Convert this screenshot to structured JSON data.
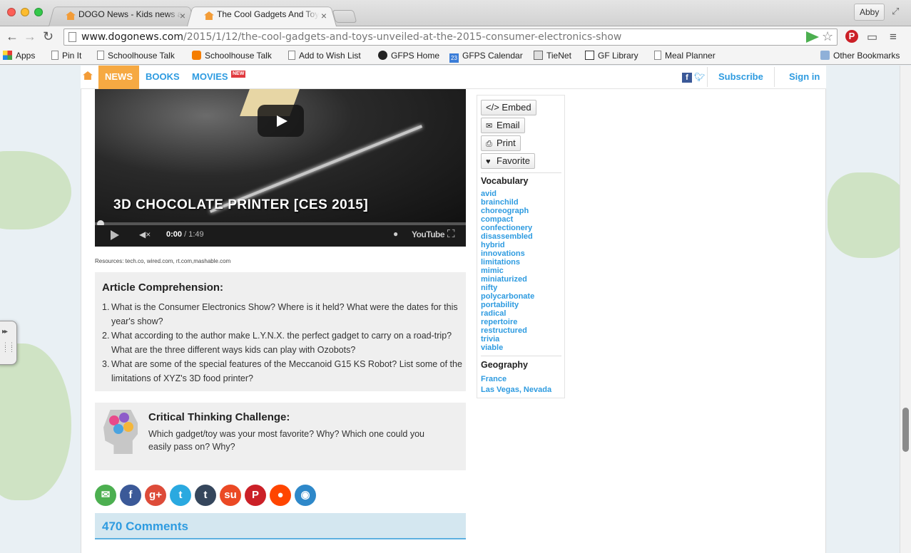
{
  "browser": {
    "tabs": [
      {
        "title": "DOGO News - Kids news a",
        "active": false
      },
      {
        "title": "The Cool Gadgets And Toy",
        "active": true
      }
    ],
    "profile_name": "Abby",
    "url_host": "www.dogonews.com",
    "url_path": "/2015/1/12/the-cool-gadgets-and-toys-unveiled-at-the-2015-consumer-electronics-show",
    "bookmarks": [
      "Apps",
      "Pin It",
      "Schoolhouse Talk",
      "Schoolhouse Talk",
      "Add to Wish List",
      "GFPS Home",
      "GFPS Calendar",
      "TieNet",
      "GF Library",
      "Meal Planner"
    ],
    "other_bookmarks": "Other Bookmarks",
    "calendar_day": "23"
  },
  "site_nav": {
    "news": "NEWS",
    "books": "BOOKS",
    "movies": "MOVIES",
    "movies_badge": "NEW",
    "subscribe": "Subscribe",
    "sign_in": "Sign in"
  },
  "video": {
    "title": "3D CHOCOLATE PRINTER [CES 2015]",
    "current_time": "0:00",
    "total_time": "/ 1:49",
    "youtube_label": "YouTube"
  },
  "resources": "Resources: tech.co, wired.com, rt.com,mashable.com",
  "comprehension": {
    "title": "Article Comprehension:",
    "questions": [
      {
        "num": "1.",
        "line1": "What is the Consumer Electronics Show? Where is it held? What were the dates for this",
        "line2": "year's show?"
      },
      {
        "num": "2.",
        "line1": "What according to the author make L.Y.N.X. the perfect gadget to carry on a road-trip?",
        "line2": "What are the three different ways kids can play with Ozobots?"
      },
      {
        "num": "3.",
        "line1": "What are some of the special features of the Meccanoid G15 KS Robot? List some of the",
        "line2": "limitations of XYZ's 3D food printer?"
      }
    ]
  },
  "critical_thinking": {
    "title": "Critical Thinking Challenge:",
    "line1": "Which gadget/toy was your most favorite? Why? Which one could you",
    "line2": "easily pass on? Why?"
  },
  "share_icons": [
    {
      "name": "email",
      "color": "#4caf50",
      "glyph": "✉"
    },
    {
      "name": "facebook",
      "color": "#3b5998",
      "glyph": "f"
    },
    {
      "name": "google-plus",
      "color": "#dd4b39",
      "glyph": "g+"
    },
    {
      "name": "twitter",
      "color": "#2aa9e0",
      "glyph": "t"
    },
    {
      "name": "tumblr",
      "color": "#35465c",
      "glyph": "t"
    },
    {
      "name": "stumbleupon",
      "color": "#eb4924",
      "glyph": "su"
    },
    {
      "name": "pinterest",
      "color": "#cb2027",
      "glyph": "P"
    },
    {
      "name": "reddit",
      "color": "#ff4500",
      "glyph": "●"
    },
    {
      "name": "other",
      "color": "#2e88c9",
      "glyph": "◉"
    }
  ],
  "comments": "470 Comments",
  "sidebar": {
    "embed": "</> Embed",
    "email": "Email",
    "print": "Print",
    "favorite": "Favorite",
    "vocab_title": "Vocabulary",
    "vocab": [
      "avid",
      "brainchild",
      "choreograph",
      "compact",
      "confectionery",
      "disassembled",
      "hybrid",
      "innovations",
      "limitations",
      "mimic",
      "miniaturized",
      "nifty",
      "polycarbonate",
      "portability",
      "radical",
      "repertoire",
      "restructured",
      "trivia",
      "viable"
    ],
    "geo_title": "Geography",
    "geo": [
      "France",
      "Las Vegas, Nevada"
    ]
  }
}
